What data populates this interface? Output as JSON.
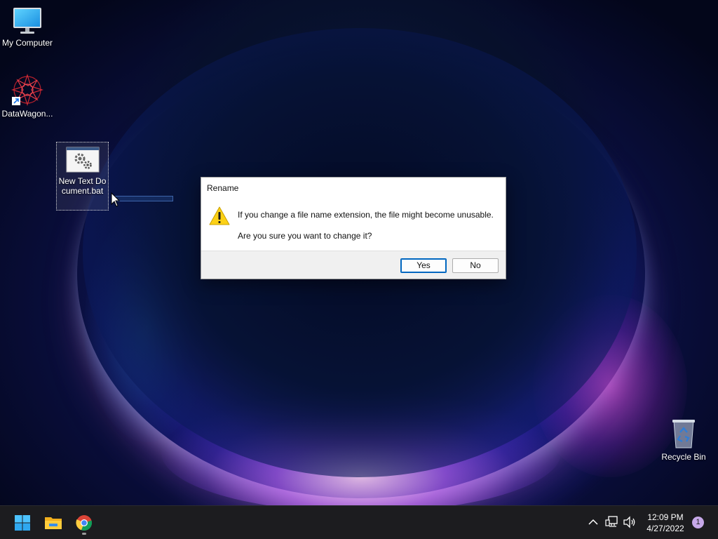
{
  "desktop": {
    "icons": {
      "my_computer": "My Computer",
      "datawagon": "DataWagon...",
      "text_document": "New Text Document.bat",
      "recycle_bin": "Recycle Bin"
    }
  },
  "dialog": {
    "title": "Rename",
    "message_line1": "If you change a file name extension, the file might become unusable.",
    "message_line2": "Are you sure you want to change it?",
    "yes_label": "Yes",
    "no_label": "No",
    "icon": "warning-icon"
  },
  "taskbar": {
    "apps": [
      "start-icon",
      "file-explorer-icon",
      "chrome-icon"
    ],
    "tray_icons": [
      "chevron-up-icon",
      "network-icon",
      "volume-icon"
    ],
    "clock_time": "12:09 PM",
    "clock_date": "4/27/2022",
    "notification_count": "1"
  },
  "colors": {
    "accent": "#0067c0",
    "taskbar": "#1c1c1f",
    "dialog_footer": "#f0f0f0",
    "notification_badge": "#c6a8e8"
  }
}
